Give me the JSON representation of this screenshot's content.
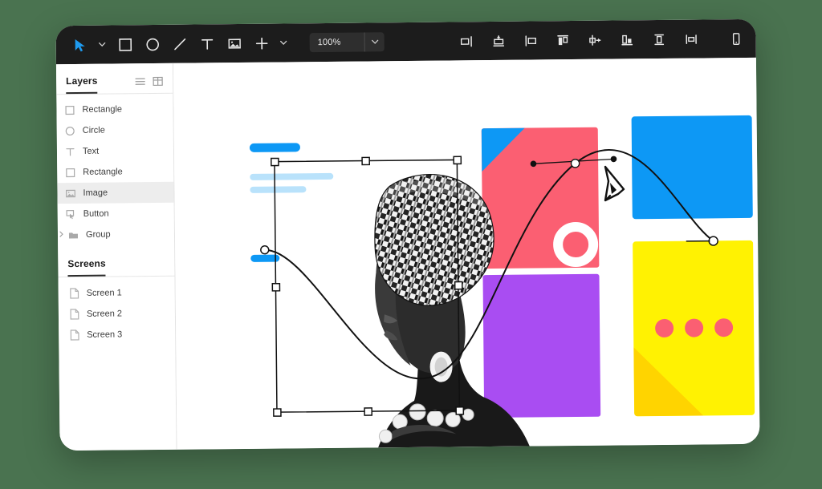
{
  "app": {
    "background_color": "#4a7350",
    "window_bg": "#ffffff",
    "toolbar_bg": "#1c1c1c",
    "accent_color": "#0d98f5"
  },
  "toolbar": {
    "tools": [
      {
        "name": "select-tool",
        "icon": "cursor-arrow-icon",
        "active": true,
        "has_chevron": true
      },
      {
        "name": "rectangle-tool",
        "icon": "square-icon",
        "active": false,
        "has_chevron": false
      },
      {
        "name": "ellipse-tool",
        "icon": "circle-icon",
        "active": false,
        "has_chevron": false
      },
      {
        "name": "line-tool",
        "icon": "line-icon",
        "active": false,
        "has_chevron": false
      },
      {
        "name": "text-tool",
        "icon": "text-t-icon",
        "active": false,
        "has_chevron": false
      },
      {
        "name": "image-tool",
        "icon": "image-icon",
        "active": false,
        "has_chevron": false
      },
      {
        "name": "add-tool",
        "icon": "plus-icon",
        "active": false,
        "has_chevron": true
      }
    ],
    "zoom": {
      "value": "100%",
      "dropdown_icon": "chevron-down-icon"
    },
    "align_tools": [
      {
        "name": "align-left",
        "icon": "align-left-icon"
      },
      {
        "name": "align-center-horizontal",
        "icon": "align-center-horizontal-icon"
      },
      {
        "name": "align-right",
        "icon": "align-right-icon"
      },
      {
        "name": "align-top",
        "icon": "align-top-icon"
      },
      {
        "name": "align-middle-vertical",
        "icon": "align-middle-vertical-icon"
      },
      {
        "name": "align-bottom",
        "icon": "align-bottom-icon"
      },
      {
        "name": "distribute-vertical",
        "icon": "distribute-vertical-icon"
      },
      {
        "name": "distribute-horizontal",
        "icon": "distribute-horizontal-icon"
      }
    ],
    "right_tools": [
      {
        "name": "device-preview",
        "icon": "mobile-device-icon"
      },
      {
        "name": "present",
        "icon": "play-icon"
      },
      {
        "name": "share",
        "icon": "upload-icon"
      }
    ]
  },
  "sidebar": {
    "layers_panel": {
      "title": "Layers",
      "view_toggles": [
        {
          "name": "list-view-toggle",
          "icon": "list-icon"
        },
        {
          "name": "grid-view-toggle",
          "icon": "grid-icon"
        }
      ],
      "items": [
        {
          "label": "Rectangle",
          "icon": "square-icon",
          "selected": false,
          "expandable": false
        },
        {
          "label": "Circle",
          "icon": "circle-icon",
          "selected": false,
          "expandable": false
        },
        {
          "label": "Text",
          "icon": "text-t-icon",
          "selected": false,
          "expandable": false
        },
        {
          "label": "Rectangle",
          "icon": "square-icon",
          "selected": false,
          "expandable": false
        },
        {
          "label": "Image",
          "icon": "image-icon",
          "selected": true,
          "expandable": false
        },
        {
          "label": "Button",
          "icon": "button-click-icon",
          "selected": false,
          "expandable": false
        },
        {
          "label": "Group",
          "icon": "folder-icon",
          "selected": false,
          "expandable": true
        }
      ]
    },
    "screens_panel": {
      "title": "Screens",
      "items": [
        {
          "label": "Screen 1",
          "icon": "page-icon"
        },
        {
          "label": "Screen 2",
          "icon": "page-icon"
        },
        {
          "label": "Screen 3",
          "icon": "page-icon"
        }
      ]
    }
  },
  "canvas": {
    "placeholder_bars": [
      {
        "name": "bar-primary-1",
        "color": "#0d98f5"
      },
      {
        "name": "bar-light-1",
        "color": "#b9e2fb"
      },
      {
        "name": "bar-light-2",
        "color": "#b9e2fb"
      },
      {
        "name": "bar-primary-2",
        "color": "#0d98f5"
      }
    ],
    "shapes": [
      {
        "name": "pink-card",
        "color": "#fb5f72",
        "accent": "#0d98f5",
        "detail": "white-ring"
      },
      {
        "name": "purple-card",
        "color": "#a94df2"
      },
      {
        "name": "blue-card",
        "color": "#0d98f5"
      },
      {
        "name": "yellow-card",
        "color": "#fff202",
        "accent": "#ffd400",
        "dots": 3,
        "dot_color": "#fb5f72"
      }
    ],
    "image_layer": {
      "name": "portrait-image",
      "description": "black-and-white portrait"
    },
    "selection": {
      "name": "image-selection-box",
      "handle_fill": "#ffffff",
      "handle_stroke": "#111111"
    },
    "pen_path": {
      "name": "bezier-curve-path",
      "stroke": "#111111",
      "anchor_fill": "#ffffff",
      "control_fill": "#111111"
    },
    "cursor": {
      "name": "pen-tool-cursor",
      "icon": "pen-nib-icon"
    }
  }
}
